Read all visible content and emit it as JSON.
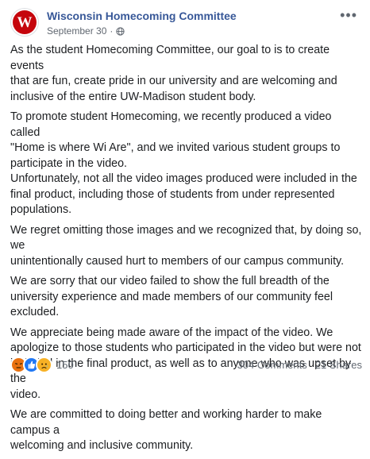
{
  "post": {
    "page_name": "Wisconsin Homecoming Committee",
    "date": "September 30",
    "separator": "·",
    "avatar_letter": "W",
    "paragraphs": [
      "As the student Homecoming Committee, our goal to is to create events\nthat are fun, create pride in our university and are welcoming and\ninclusive of the entire UW-Madison student body.",
      "To promote student Homecoming, we recently produced a video called\n\"Home is where Wi Are\", and we invited various student groups to\nparticipate in the video.\nUnfortunately, not all the video images produced were included in the\nfinal product, including those of students from under represented\npopulations.",
      "We regret omitting those images and we recognized that, by doing so, we\nunintentionally caused hurt to members of our campus community.",
      "We are sorry that our video failed to show the full breadth of the\nuniversity experience and made members of our community feel\nexcluded.",
      "We appreciate being made aware of the impact of the video. We\napologize to those students who participated in the video but were not\nincluded in the final product, as well as to anyone who was upset by the\nvideo.",
      "We are committed to doing better and working harder to make campus a\nwelcoming and inclusive community."
    ]
  },
  "footer": {
    "reaction_count": "150",
    "comments": "304 Comments",
    "shares": "21 Shares",
    "reactions": [
      "angry-reaction-icon",
      "like-reaction-icon",
      "sad-reaction-icon"
    ]
  },
  "colors": {
    "brand_red": "#c5050c",
    "link_blue": "#385898",
    "muted": "#606770"
  }
}
